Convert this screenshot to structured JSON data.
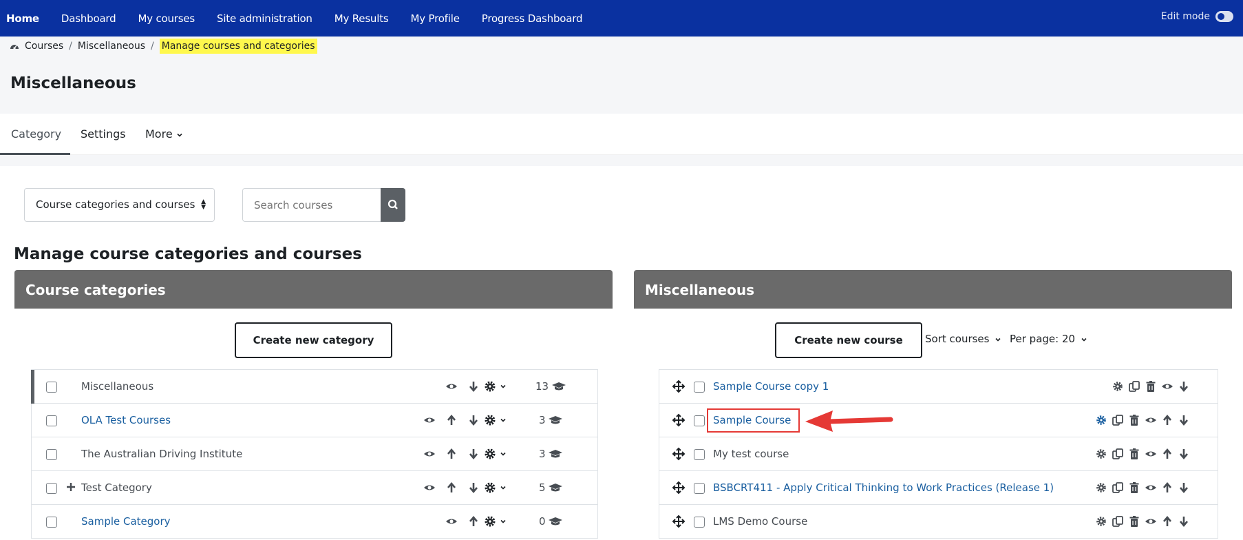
{
  "topnav": {
    "items": [
      "Home",
      "Dashboard",
      "My courses",
      "Site administration",
      "My Results",
      "My Profile",
      "Progress Dashboard"
    ],
    "edit_mode_label": "Edit mode"
  },
  "breadcrumb": {
    "items": [
      "Courses",
      "Miscellaneous",
      "Manage courses and categories"
    ]
  },
  "page_title": "Miscellaneous",
  "subnav": {
    "tabs": [
      "Category",
      "Settings",
      "More"
    ]
  },
  "view_select": {
    "value": "Course categories and courses"
  },
  "search": {
    "placeholder": "Search courses"
  },
  "section_title": "Manage course categories and courses",
  "categories_panel": {
    "title": "Course categories",
    "create_button": "Create new category",
    "rows": [
      {
        "name": "Miscellaneous",
        "count": "13"
      },
      {
        "name": "OLA Test Courses",
        "count": "3"
      },
      {
        "name": "The Australian Driving Institute",
        "count": "3"
      },
      {
        "name": "Test Category",
        "count": "5"
      },
      {
        "name": "Sample Category",
        "count": "0"
      }
    ]
  },
  "courses_panel": {
    "title": "Miscellaneous",
    "create_button": "Create new course",
    "sort_label": "Sort courses",
    "per_page_label": "Per page: 20",
    "rows": [
      {
        "name": "Sample Course copy 1"
      },
      {
        "name": "Sample Course"
      },
      {
        "name": "My test course"
      },
      {
        "name": "BSBCRT411 - Apply Critical Thinking to Work Practices (Release 1)"
      },
      {
        "name": "LMS Demo Course"
      }
    ]
  },
  "colors": {
    "navbar": "#0a31a0",
    "link": "#1a5fa0",
    "panel_header": "#6a6a6a",
    "highlight": "#fff84d",
    "annotation": "#e53935"
  }
}
